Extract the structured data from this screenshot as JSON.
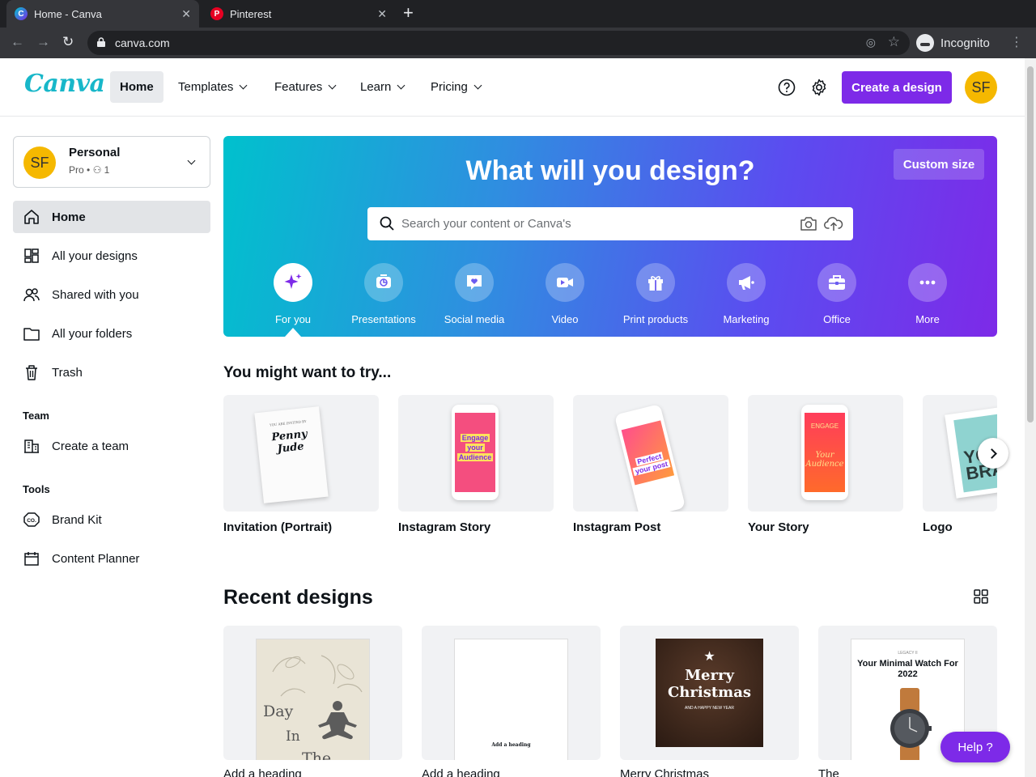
{
  "browser": {
    "tabs": [
      {
        "title": "Home - Canva",
        "favicon": "canva-favicon-icon",
        "active": true
      },
      {
        "title": "Pinterest",
        "favicon": "pinterest-favicon-icon",
        "active": false
      }
    ],
    "url": "canva.com",
    "profile_label": "Incognito"
  },
  "header": {
    "logo": "Canva",
    "nav": [
      {
        "label": "Home",
        "active": true
      },
      {
        "label": "Templates",
        "dropdown": true
      },
      {
        "label": "Features",
        "dropdown": true
      },
      {
        "label": "Learn",
        "dropdown": true
      },
      {
        "label": "Pricing",
        "dropdown": true
      }
    ],
    "create_label": "Create a design",
    "avatar_initials": "SF"
  },
  "sidebar": {
    "account": {
      "initials": "SF",
      "name": "Personal",
      "plan": "Pro",
      "members": "1"
    },
    "items": [
      {
        "label": "Home",
        "icon": "home-icon",
        "active": true
      },
      {
        "label": "All your designs",
        "icon": "grid-designs-icon"
      },
      {
        "label": "Shared with you",
        "icon": "users-icon"
      },
      {
        "label": "All your folders",
        "icon": "folder-icon"
      },
      {
        "label": "Trash",
        "icon": "trash-icon"
      }
    ],
    "team_heading": "Team",
    "team_items": [
      {
        "label": "Create a team",
        "icon": "building-icon"
      }
    ],
    "tools_heading": "Tools",
    "tools_items": [
      {
        "label": "Brand Kit",
        "icon": "brand-kit-icon"
      },
      {
        "label": "Content Planner",
        "icon": "calendar-icon"
      }
    ]
  },
  "hero": {
    "title": "What will you design?",
    "custom_size_label": "Custom size",
    "search_placeholder": "Search your content or Canva's",
    "categories": [
      {
        "label": "For you",
        "icon": "sparkle-icon",
        "active": true
      },
      {
        "label": "Presentations",
        "icon": "presentation-icon"
      },
      {
        "label": "Social media",
        "icon": "heart-chat-icon"
      },
      {
        "label": "Video",
        "icon": "video-camera-icon"
      },
      {
        "label": "Print products",
        "icon": "gift-icon"
      },
      {
        "label": "Marketing",
        "icon": "megaphone-icon"
      },
      {
        "label": "Office",
        "icon": "briefcase-icon"
      },
      {
        "label": "More",
        "icon": "more-dots-icon"
      }
    ]
  },
  "suggestions": {
    "title": "You might want to try...",
    "items": [
      {
        "label": "Invitation (Portrait)",
        "thumb_text": [
          "YOU ARE INVITED BY",
          "Penny",
          "Jude"
        ]
      },
      {
        "label": "Instagram Story",
        "thumb_text": [
          "Engage",
          "your",
          "Audience"
        ]
      },
      {
        "label": "Instagram Post",
        "thumb_text": [
          "Perfect",
          "your post"
        ]
      },
      {
        "label": "Your Story",
        "thumb_text": [
          "ENGAGE",
          "Your",
          "Audience"
        ]
      },
      {
        "label": "Logo",
        "thumb_text": [
          "YO",
          "BRA"
        ]
      }
    ]
  },
  "recent": {
    "title": "Recent designs",
    "items": [
      {
        "label": "Add a heading",
        "thumb_text": [
          "Day",
          "In",
          "The"
        ]
      },
      {
        "label": "Add a heading",
        "thumb_text": [
          "Add a heading"
        ]
      },
      {
        "label": "Merry Christmas",
        "thumb_text": [
          "Merry",
          "Christmas",
          "AND A HAPPY NEW YEAR"
        ]
      },
      {
        "label": "The",
        "thumb_text": [
          "LEGACY II",
          "Your Minimal Watch For 2022"
        ]
      }
    ]
  },
  "help_label": "Help",
  "colors": {
    "brand_purple": "#7d2ae8",
    "logo_teal": "#18b7c9",
    "avatar_yellow": "#f5b800",
    "hero_start": "#00c1cd",
    "hero_end": "#7d2ae8"
  }
}
